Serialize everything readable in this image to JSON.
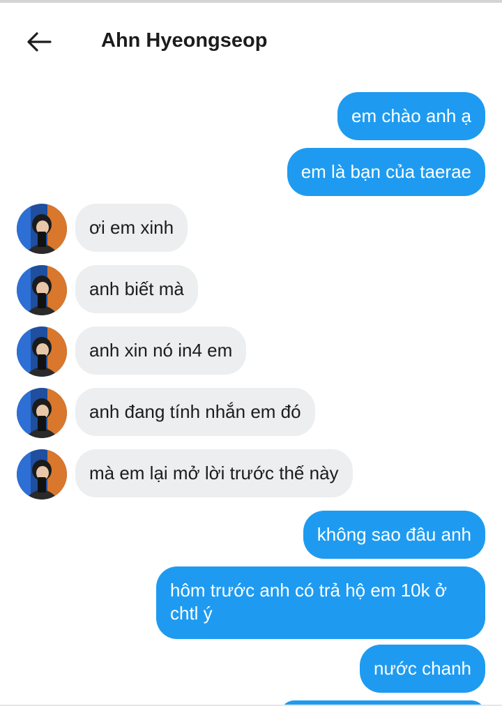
{
  "header": {
    "title": "Ahn Hyeongseop",
    "back_icon": "arrow-left-icon"
  },
  "colors": {
    "sent_bubble": "#1e9bf0",
    "received_bubble": "#eceeef",
    "text_dark": "#1c1c1c"
  },
  "messages": [
    {
      "side": "sent",
      "text": "em chào anh ạ"
    },
    {
      "side": "sent",
      "text": "em là bạn của taerae"
    },
    {
      "side": "received",
      "text": "ơi em xinh"
    },
    {
      "side": "received",
      "text": "anh biết mà"
    },
    {
      "side": "received",
      "text": "anh xin nó in4 em"
    },
    {
      "side": "received",
      "text": "anh đang tính nhắn em đó"
    },
    {
      "side": "received",
      "text": "mà em lại mở lời trước thế này"
    },
    {
      "side": "sent",
      "text": "không sao đâu anh"
    },
    {
      "side": "sent",
      "text": "hôm trước anh có trả hộ em 10k ở chtl ý"
    },
    {
      "side": "sent",
      "text": "nước chanh"
    },
    {
      "side": "sent",
      "text": ""
    }
  ]
}
